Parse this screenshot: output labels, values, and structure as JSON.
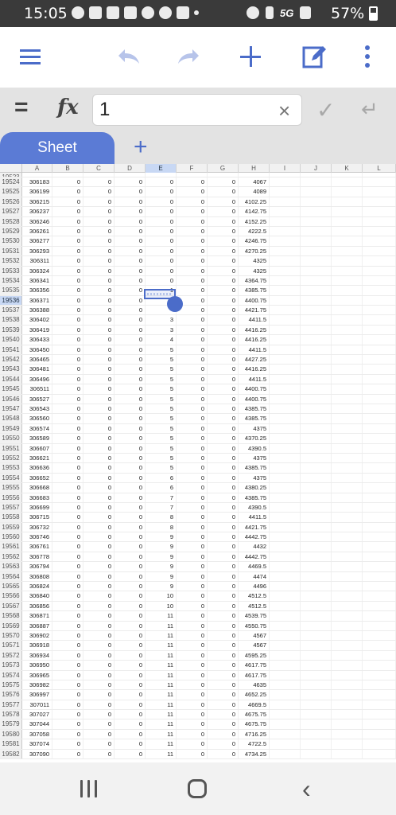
{
  "status_bar": {
    "time": "15:05",
    "battery": "57%",
    "network": "5G"
  },
  "formula_bar": {
    "equals_label": "=",
    "fx_label": "fx",
    "value": "1",
    "clear_glyph": "×",
    "confirm_glyph": "✓",
    "enter_glyph": "↵"
  },
  "tabs": {
    "sheet_label": "Sheet",
    "add_glyph": "+"
  },
  "columns": [
    "A",
    "B",
    "C",
    "D",
    "E",
    "F",
    "G",
    "H",
    "I",
    "J",
    "K",
    "L"
  ],
  "selected_column": "E",
  "active_row": "19536",
  "accent_color": "#4b6cc9",
  "rows": [
    {
      "n": "19523",
      "a": "",
      "b": "",
      "c": "",
      "d": "",
      "e": "",
      "f": "",
      "g": "",
      "h": ""
    },
    {
      "n": "19524",
      "a": "306183",
      "b": "0",
      "c": "0",
      "d": "0",
      "e": "0",
      "f": "0",
      "g": "0",
      "h": "4067"
    },
    {
      "n": "19525",
      "a": "306199",
      "b": "0",
      "c": "0",
      "d": "0",
      "e": "0",
      "f": "0",
      "g": "0",
      "h": "4089"
    },
    {
      "n": "19526",
      "a": "306215",
      "b": "0",
      "c": "0",
      "d": "0",
      "e": "0",
      "f": "0",
      "g": "0",
      "h": "4102.25"
    },
    {
      "n": "19527",
      "a": "306237",
      "b": "0",
      "c": "0",
      "d": "0",
      "e": "0",
      "f": "0",
      "g": "0",
      "h": "4142.75"
    },
    {
      "n": "19528",
      "a": "306246",
      "b": "0",
      "c": "0",
      "d": "0",
      "e": "0",
      "f": "0",
      "g": "0",
      "h": "4152.25"
    },
    {
      "n": "19529",
      "a": "306261",
      "b": "0",
      "c": "0",
      "d": "0",
      "e": "0",
      "f": "0",
      "g": "0",
      "h": "4222.5"
    },
    {
      "n": "19530",
      "a": "306277",
      "b": "0",
      "c": "0",
      "d": "0",
      "e": "0",
      "f": "0",
      "g": "0",
      "h": "4246.75"
    },
    {
      "n": "19531",
      "a": "306293",
      "b": "0",
      "c": "0",
      "d": "0",
      "e": "0",
      "f": "0",
      "g": "0",
      "h": "4270.25"
    },
    {
      "n": "19532",
      "a": "306311",
      "b": "0",
      "c": "0",
      "d": "0",
      "e": "0",
      "f": "0",
      "g": "0",
      "h": "4325"
    },
    {
      "n": "19533",
      "a": "306324",
      "b": "0",
      "c": "0",
      "d": "0",
      "e": "0",
      "f": "0",
      "g": "0",
      "h": "4325"
    },
    {
      "n": "19534",
      "a": "306341",
      "b": "0",
      "c": "0",
      "d": "0",
      "e": "0",
      "f": "0",
      "g": "0",
      "h": "4364.75"
    },
    {
      "n": "19535",
      "a": "306356",
      "b": "0",
      "c": "0",
      "d": "0",
      "e": "1",
      "f": "0",
      "g": "0",
      "h": "4385.75"
    },
    {
      "n": "19536",
      "a": "306371",
      "b": "0",
      "c": "0",
      "d": "0",
      "e": "",
      "f": "0",
      "g": "0",
      "h": "4400.75"
    },
    {
      "n": "19537",
      "a": "306388",
      "b": "0",
      "c": "0",
      "d": "0",
      "e": "",
      "f": "0",
      "g": "0",
      "h": "4421.75"
    },
    {
      "n": "19538",
      "a": "306402",
      "b": "0",
      "c": "0",
      "d": "0",
      "e": "3",
      "f": "0",
      "g": "0",
      "h": "4411.5"
    },
    {
      "n": "19539",
      "a": "306419",
      "b": "0",
      "c": "0",
      "d": "0",
      "e": "3",
      "f": "0",
      "g": "0",
      "h": "4416.25"
    },
    {
      "n": "19540",
      "a": "306433",
      "b": "0",
      "c": "0",
      "d": "0",
      "e": "4",
      "f": "0",
      "g": "0",
      "h": "4416.25"
    },
    {
      "n": "19541",
      "a": "306450",
      "b": "0",
      "c": "0",
      "d": "0",
      "e": "5",
      "f": "0",
      "g": "0",
      "h": "4411.5"
    },
    {
      "n": "19542",
      "a": "306465",
      "b": "0",
      "c": "0",
      "d": "0",
      "e": "5",
      "f": "0",
      "g": "0",
      "h": "4427.25"
    },
    {
      "n": "19543",
      "a": "306481",
      "b": "0",
      "c": "0",
      "d": "0",
      "e": "5",
      "f": "0",
      "g": "0",
      "h": "4416.25"
    },
    {
      "n": "19544",
      "a": "306496",
      "b": "0",
      "c": "0",
      "d": "0",
      "e": "5",
      "f": "0",
      "g": "0",
      "h": "4411.5"
    },
    {
      "n": "19545",
      "a": "306511",
      "b": "0",
      "c": "0",
      "d": "0",
      "e": "5",
      "f": "0",
      "g": "0",
      "h": "4400.75"
    },
    {
      "n": "19546",
      "a": "306527",
      "b": "0",
      "c": "0",
      "d": "0",
      "e": "5",
      "f": "0",
      "g": "0",
      "h": "4400.75"
    },
    {
      "n": "19547",
      "a": "306543",
      "b": "0",
      "c": "0",
      "d": "0",
      "e": "5",
      "f": "0",
      "g": "0",
      "h": "4385.75"
    },
    {
      "n": "19548",
      "a": "306560",
      "b": "0",
      "c": "0",
      "d": "0",
      "e": "5",
      "f": "0",
      "g": "0",
      "h": "4385.75"
    },
    {
      "n": "19549",
      "a": "306574",
      "b": "0",
      "c": "0",
      "d": "0",
      "e": "5",
      "f": "0",
      "g": "0",
      "h": "4375"
    },
    {
      "n": "19550",
      "a": "306589",
      "b": "0",
      "c": "0",
      "d": "0",
      "e": "5",
      "f": "0",
      "g": "0",
      "h": "4370.25"
    },
    {
      "n": "19551",
      "a": "306607",
      "b": "0",
      "c": "0",
      "d": "0",
      "e": "5",
      "f": "0",
      "g": "0",
      "h": "4390.5"
    },
    {
      "n": "19552",
      "a": "306621",
      "b": "0",
      "c": "0",
      "d": "0",
      "e": "5",
      "f": "0",
      "g": "0",
      "h": "4375"
    },
    {
      "n": "19553",
      "a": "306636",
      "b": "0",
      "c": "0",
      "d": "0",
      "e": "5",
      "f": "0",
      "g": "0",
      "h": "4385.75"
    },
    {
      "n": "19554",
      "a": "306652",
      "b": "0",
      "c": "0",
      "d": "0",
      "e": "6",
      "f": "0",
      "g": "0",
      "h": "4375"
    },
    {
      "n": "19555",
      "a": "306668",
      "b": "0",
      "c": "0",
      "d": "0",
      "e": "6",
      "f": "0",
      "g": "0",
      "h": "4380.25"
    },
    {
      "n": "19556",
      "a": "306683",
      "b": "0",
      "c": "0",
      "d": "0",
      "e": "7",
      "f": "0",
      "g": "0",
      "h": "4385.75"
    },
    {
      "n": "19557",
      "a": "306699",
      "b": "0",
      "c": "0",
      "d": "0",
      "e": "7",
      "f": "0",
      "g": "0",
      "h": "4390.5"
    },
    {
      "n": "19558",
      "a": "306715",
      "b": "0",
      "c": "0",
      "d": "0",
      "e": "8",
      "f": "0",
      "g": "0",
      "h": "4411.5"
    },
    {
      "n": "19559",
      "a": "306732",
      "b": "0",
      "c": "0",
      "d": "0",
      "e": "8",
      "f": "0",
      "g": "0",
      "h": "4421.75"
    },
    {
      "n": "19560",
      "a": "306746",
      "b": "0",
      "c": "0",
      "d": "0",
      "e": "9",
      "f": "0",
      "g": "0",
      "h": "4442.75"
    },
    {
      "n": "19561",
      "a": "306761",
      "b": "0",
      "c": "0",
      "d": "0",
      "e": "9",
      "f": "0",
      "g": "0",
      "h": "4432"
    },
    {
      "n": "19562",
      "a": "306778",
      "b": "0",
      "c": "0",
      "d": "0",
      "e": "9",
      "f": "0",
      "g": "0",
      "h": "4442.75"
    },
    {
      "n": "19563",
      "a": "306794",
      "b": "0",
      "c": "0",
      "d": "0",
      "e": "9",
      "f": "0",
      "g": "0",
      "h": "4469.5"
    },
    {
      "n": "19564",
      "a": "306808",
      "b": "0",
      "c": "0",
      "d": "0",
      "e": "9",
      "f": "0",
      "g": "0",
      "h": "4474"
    },
    {
      "n": "19565",
      "a": "306824",
      "b": "0",
      "c": "0",
      "d": "0",
      "e": "9",
      "f": "0",
      "g": "0",
      "h": "4496"
    },
    {
      "n": "19566",
      "a": "306840",
      "b": "0",
      "c": "0",
      "d": "0",
      "e": "10",
      "f": "0",
      "g": "0",
      "h": "4512.5"
    },
    {
      "n": "19567",
      "a": "306856",
      "b": "0",
      "c": "0",
      "d": "0",
      "e": "10",
      "f": "0",
      "g": "0",
      "h": "4512.5"
    },
    {
      "n": "19568",
      "a": "306871",
      "b": "0",
      "c": "0",
      "d": "0",
      "e": "11",
      "f": "0",
      "g": "0",
      "h": "4539.75"
    },
    {
      "n": "19569",
      "a": "306887",
      "b": "0",
      "c": "0",
      "d": "0",
      "e": "11",
      "f": "0",
      "g": "0",
      "h": "4550.75"
    },
    {
      "n": "19570",
      "a": "306902",
      "b": "0",
      "c": "0",
      "d": "0",
      "e": "11",
      "f": "0",
      "g": "0",
      "h": "4567"
    },
    {
      "n": "19571",
      "a": "306918",
      "b": "0",
      "c": "0",
      "d": "0",
      "e": "11",
      "f": "0",
      "g": "0",
      "h": "4567"
    },
    {
      "n": "19572",
      "a": "306934",
      "b": "0",
      "c": "0",
      "d": "0",
      "e": "11",
      "f": "0",
      "g": "0",
      "h": "4595.25"
    },
    {
      "n": "19573",
      "a": "306950",
      "b": "0",
      "c": "0",
      "d": "0",
      "e": "11",
      "f": "0",
      "g": "0",
      "h": "4617.75"
    },
    {
      "n": "19574",
      "a": "306965",
      "b": "0",
      "c": "0",
      "d": "0",
      "e": "11",
      "f": "0",
      "g": "0",
      "h": "4617.75"
    },
    {
      "n": "19575",
      "a": "306982",
      "b": "0",
      "c": "0",
      "d": "0",
      "e": "11",
      "f": "0",
      "g": "0",
      "h": "4635"
    },
    {
      "n": "19576",
      "a": "306997",
      "b": "0",
      "c": "0",
      "d": "0",
      "e": "11",
      "f": "0",
      "g": "0",
      "h": "4652.25"
    },
    {
      "n": "19577",
      "a": "307011",
      "b": "0",
      "c": "0",
      "d": "0",
      "e": "11",
      "f": "0",
      "g": "0",
      "h": "4669.5"
    },
    {
      "n": "19578",
      "a": "307027",
      "b": "0",
      "c": "0",
      "d": "0",
      "e": "11",
      "f": "0",
      "g": "0",
      "h": "4675.75"
    },
    {
      "n": "19579",
      "a": "307044",
      "b": "0",
      "c": "0",
      "d": "0",
      "e": "11",
      "f": "0",
      "g": "0",
      "h": "4675.75"
    },
    {
      "n": "19580",
      "a": "307058",
      "b": "0",
      "c": "0",
      "d": "0",
      "e": "11",
      "f": "0",
      "g": "0",
      "h": "4716.25"
    },
    {
      "n": "19581",
      "a": "307074",
      "b": "0",
      "c": "0",
      "d": "0",
      "e": "11",
      "f": "0",
      "g": "0",
      "h": "4722.5"
    },
    {
      "n": "19582",
      "a": "307090",
      "b": "0",
      "c": "0",
      "d": "0",
      "e": "11",
      "f": "0",
      "g": "0",
      "h": "4734.25"
    }
  ]
}
